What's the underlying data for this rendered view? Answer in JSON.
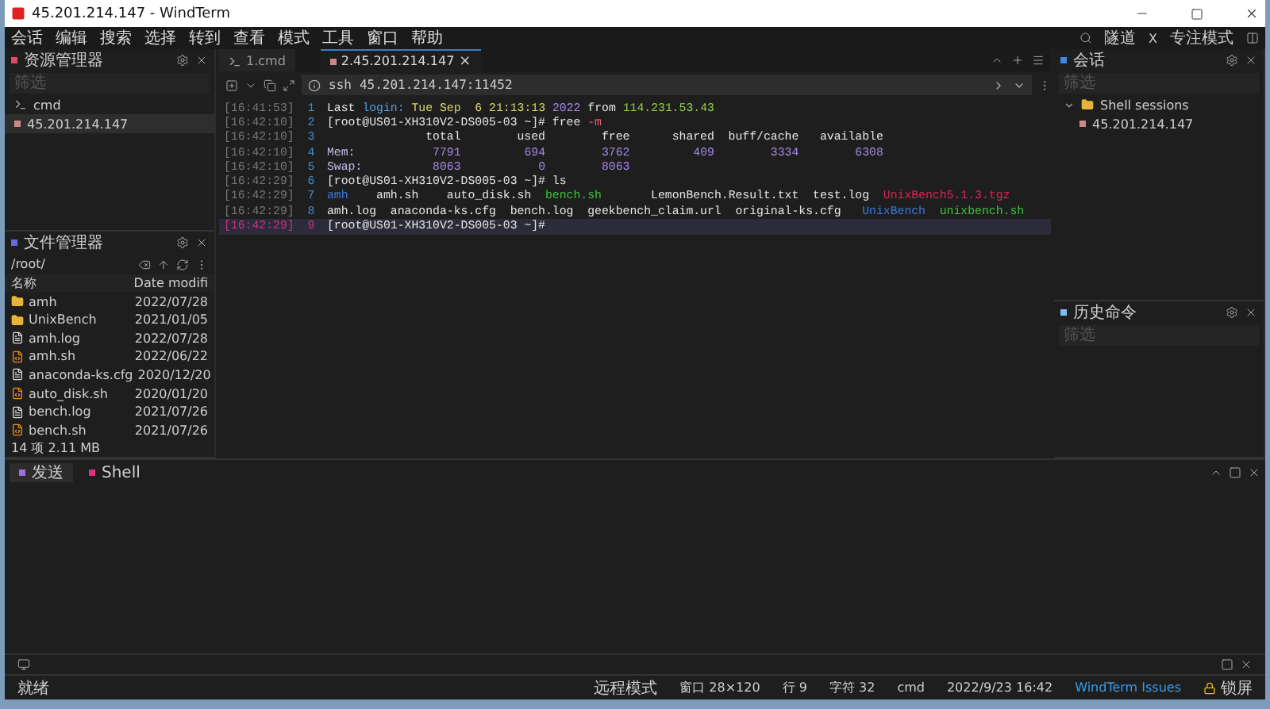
{
  "window": {
    "title": "45.201.214.147 - WindTerm"
  },
  "menu": [
    "会话",
    "编辑",
    "搜索",
    "选择",
    "转到",
    "查看",
    "模式",
    "工具",
    "窗口",
    "帮助"
  ],
  "toolbar_right": [
    "隧道",
    "X",
    "专注模式"
  ],
  "explorer": {
    "title": "资源管理器",
    "filter": {
      "placeholder": "筛选"
    },
    "items": [
      {
        "label": "cmd",
        "kind": "local",
        "selected": false
      },
      {
        "label": "45.201.214.147",
        "kind": "remote",
        "selected": true
      }
    ]
  },
  "file_manager": {
    "title": "文件管理器",
    "path": "/root/",
    "columns": [
      "名称",
      "Date modifi"
    ],
    "rows": [
      {
        "name": "amh",
        "date": "2022/07/28",
        "kind": "folder"
      },
      {
        "name": "UnixBench",
        "date": "2021/01/05",
        "kind": "folder"
      },
      {
        "name": "amh.log",
        "date": "2022/07/28",
        "kind": "file"
      },
      {
        "name": "amh.sh",
        "date": "2022/06/22",
        "kind": "script"
      },
      {
        "name": "anaconda-ks.cfg",
        "date": "2020/12/20",
        "kind": "file"
      },
      {
        "name": "auto_disk.sh",
        "date": "2020/01/20",
        "kind": "script"
      },
      {
        "name": "bench.log",
        "date": "2021/07/26",
        "kind": "file"
      },
      {
        "name": "bench.sh",
        "date": "2021/07/26",
        "kind": "script"
      }
    ],
    "summary": "14 项 2.11 MB"
  },
  "tabs": [
    {
      "label": "1.cmd",
      "selected": false
    },
    {
      "label": "2.45.201.214.147",
      "selected": true,
      "close": "×"
    }
  ],
  "address": {
    "protocol": "ssh",
    "host": "45.201.214.147:11452"
  },
  "terminal": [
    {
      "time": "[16:41:53]",
      "number": "1",
      "selected": false,
      "segments": [
        {
          "text": "Last ",
          "color": "#e6e6e6"
        },
        {
          "text": "login:",
          "color": "#5b9be8"
        },
        {
          "text": " Tue Sep  6 21:13:13 ",
          "color": "#d7d76a"
        },
        {
          "text": "2022",
          "color": "#a887e8"
        },
        {
          "text": " from ",
          "color": "#e6e6e6"
        },
        {
          "text": "114.231.53.43",
          "color": "#8fd04a"
        }
      ]
    },
    {
      "time": "[16:42:10]",
      "number": "2",
      "selected": false,
      "segments": [
        {
          "text": "[root@US01-XH310V2-DS005-03 ~]# free ",
          "color": "#e6e6e6"
        },
        {
          "text": "-m",
          "color": "#e8607a"
        }
      ]
    },
    {
      "time": "[16:42:10]",
      "number": "3",
      "selected": false,
      "segments": [
        {
          "text": "              total        used        free      shared  buff/cache   available",
          "color": "#e6e6e6"
        }
      ]
    },
    {
      "time": "[16:42:10]",
      "number": "4",
      "selected": false,
      "segments": [
        {
          "text": "Mem:",
          "color": "#c9b8ee"
        },
        {
          "text": "           7791         694        3762         409        3334        6308",
          "color": "#a887e8"
        }
      ]
    },
    {
      "time": "[16:42:10]",
      "number": "5",
      "selected": false,
      "segments": [
        {
          "text": "Swap:",
          "color": "#c9b8ee"
        },
        {
          "text": "          8063           0        8063",
          "color": "#a887e8"
        }
      ]
    },
    {
      "time": "[16:42:29]",
      "number": "6",
      "selected": false,
      "segments": [
        {
          "text": "[root@US01-XH310V2-DS005-03 ~]# ls",
          "color": "#e6e6e6"
        }
      ]
    },
    {
      "time": "[16:42:29]",
      "number": "7",
      "selected": false,
      "segments": [
        {
          "text": "amh",
          "color": "#3a7be0"
        },
        {
          "text": "    amh.sh    auto_disk.sh  ",
          "color": "#e6e6e6"
        },
        {
          "text": "bench.sh",
          "color": "#3cc43c"
        },
        {
          "text": "       LemonBench.Result.txt  test.log  ",
          "color": "#e6e6e6"
        },
        {
          "text": "UnixBench5.1.3.tgz",
          "color": "#e0245a"
        }
      ]
    },
    {
      "time": "[16:42:29]",
      "number": "8",
      "selected": false,
      "segments": [
        {
          "text": "amh.log  anaconda-ks.cfg  bench.log  geekbench_claim.url  original-ks.cfg   ",
          "color": "#e6e6e6"
        },
        {
          "text": "UnixBench  ",
          "color": "#3a7be0"
        },
        {
          "text": "unixbench.sh",
          "color": "#3cc43c"
        }
      ]
    },
    {
      "time": "[16:42:29]",
      "number": "9",
      "selected": true,
      "segments": [
        {
          "text": "[root@US01-XH310V2-DS005-03 ~]#",
          "color": "#e6e6e6"
        }
      ]
    }
  ],
  "sessions": {
    "title": "会话",
    "filter": {
      "placeholder": "筛选"
    },
    "tree": [
      {
        "label": "Shell sessions",
        "expanded": true,
        "children": [
          {
            "label": "45.201.214.147"
          }
        ]
      }
    ]
  },
  "history": {
    "title": "历史命令",
    "filter": {
      "placeholder": "筛选"
    }
  },
  "bottom_tabs": [
    {
      "label": "发送",
      "selected": true,
      "color": "#a070e0"
    },
    {
      "label": "Shell",
      "selected": false,
      "color": "#e0307a"
    }
  ],
  "status_bar": {
    "left": "就绪",
    "items": [
      "远程模式",
      "窗口 28×120",
      "行 9",
      "字符 32",
      "cmd",
      "2022/9/23 16:42"
    ],
    "issues": "WindTerm Issues",
    "lock": "锁屏"
  }
}
